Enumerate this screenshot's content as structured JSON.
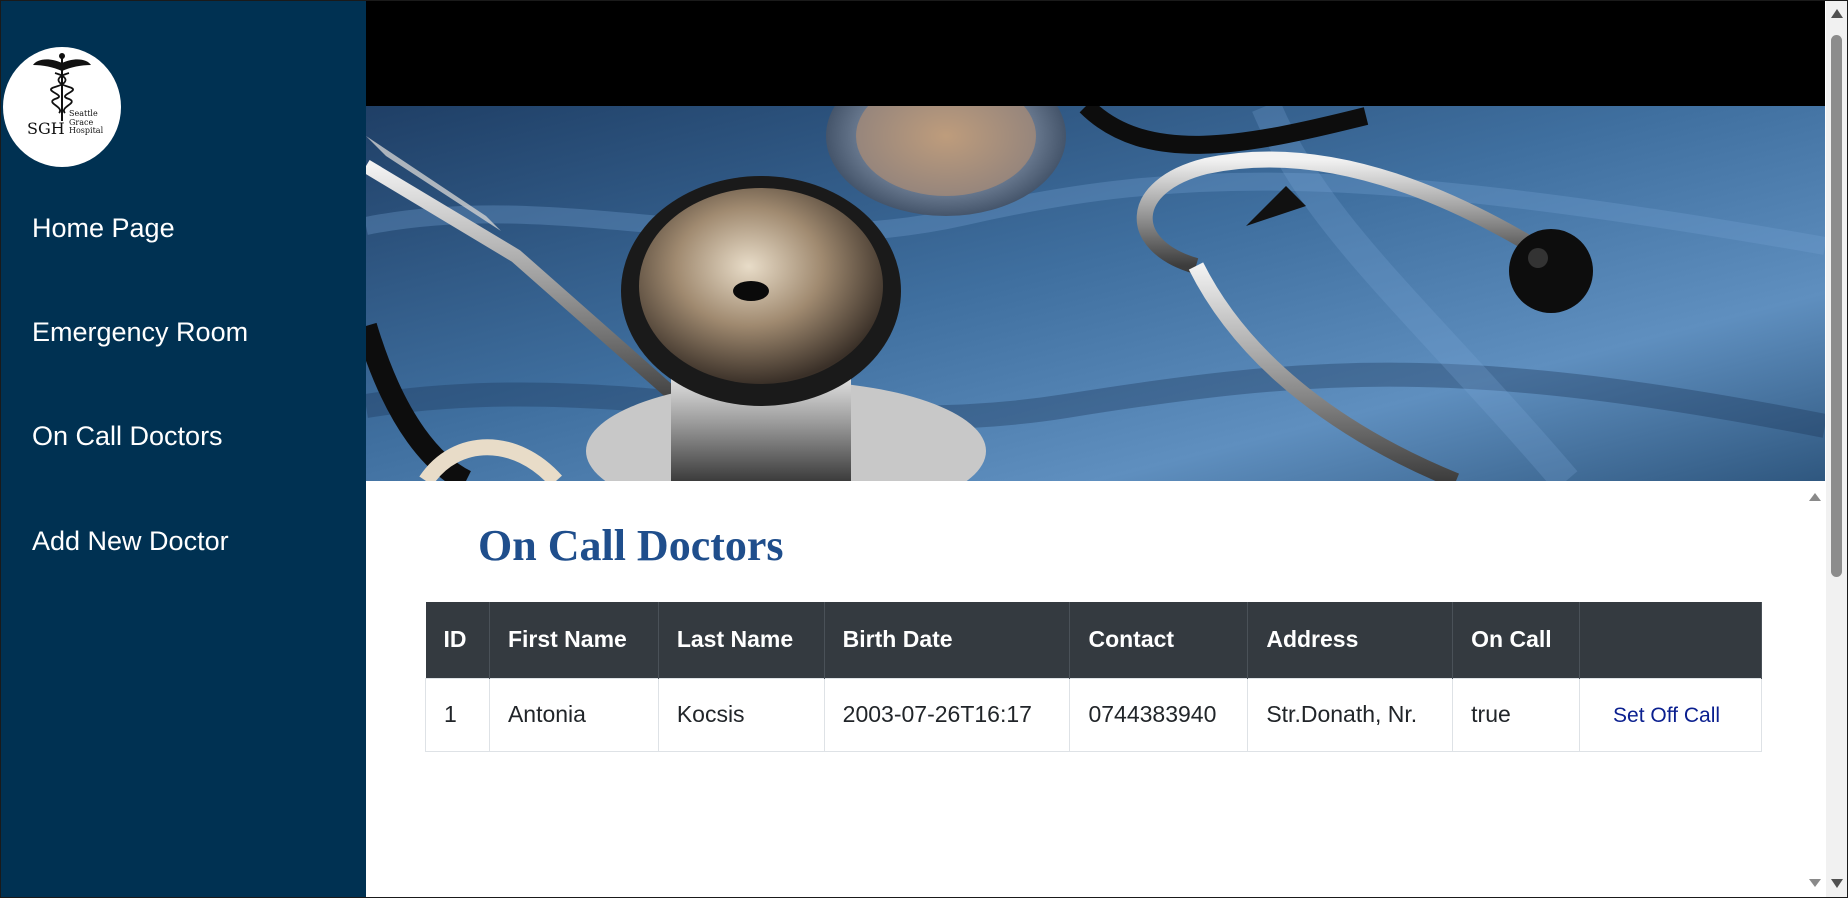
{
  "logo": {
    "abbr": "SGH",
    "name_lines": [
      "Seattle",
      "Grace",
      "Hospital"
    ]
  },
  "sidebar": {
    "items": [
      {
        "label": "Home Page"
      },
      {
        "label": "Emergency Room"
      },
      {
        "label": "On Call Doctors"
      },
      {
        "label": "Add New Doctor"
      }
    ]
  },
  "page": {
    "title": "On Call Doctors"
  },
  "table": {
    "headers": [
      "ID",
      "First Name",
      "Last Name",
      "Birth Date",
      "Contact",
      "Address",
      "On Call",
      ""
    ],
    "rows": [
      {
        "id": "1",
        "first_name": "Antonia",
        "last_name": "Kocsis",
        "birth_date": "2003-07-26T16:17",
        "contact": "0744383940",
        "address": "Str.Donath, Nr.",
        "on_call": "true",
        "action_label": "Set Off Call"
      }
    ]
  },
  "colors": {
    "sidebar_bg": "#003152",
    "title_color": "#1f4e8c",
    "table_header_bg": "#343a40",
    "action_link": "#0a1f8f"
  },
  "icons": {
    "logo_emblem": "caduceus-icon",
    "hero_image": "stethoscope-image"
  }
}
